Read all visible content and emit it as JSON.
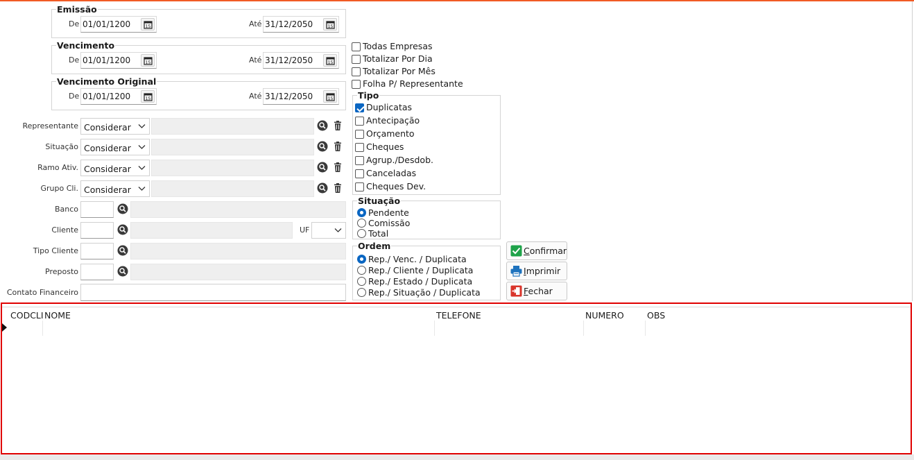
{
  "emissao": {
    "legend": "Emissão",
    "de_label": "De",
    "ate_label": "Até",
    "de_value": "01/01/1200",
    "ate_value": "31/12/2050"
  },
  "vencimento": {
    "legend": "Vencimento",
    "de_label": "De",
    "ate_label": "Até",
    "de_value": "01/01/1200",
    "ate_value": "31/12/2050"
  },
  "vencimento_original": {
    "legend": "Vencimento Original",
    "de_label": "De",
    "ate_label": "Até",
    "de_value": "01/01/1200",
    "ate_value": "31/12/2050"
  },
  "filters": {
    "representante": {
      "label": "Representante",
      "value": "Considerar"
    },
    "situacao": {
      "label": "Situação",
      "value": "Considerar"
    },
    "ramo": {
      "label": "Ramo Ativ.",
      "value": "Considerar"
    },
    "grupo": {
      "label": "Grupo Cli.",
      "value": "Considerar"
    }
  },
  "fields": {
    "banco": "Banco",
    "cliente": "Cliente",
    "uf": "UF",
    "tipo_cliente": "Tipo Cliente",
    "preposto": "Preposto",
    "contato": "Contato Financeiro"
  },
  "options": {
    "todas_empresas": "Todas Empresas",
    "totalizar_dia": "Totalizar Por Dia",
    "totalizar_mes": "Totalizar Por Mês",
    "folha_rep": "Folha P/ Representante"
  },
  "tipo": {
    "legend": "Tipo",
    "items": [
      "Duplicatas",
      "Antecipação",
      "Orçamento",
      "Cheques",
      "Agrup./Desdob.",
      "Canceladas",
      "Cheques Dev."
    ],
    "checked": [
      true,
      false,
      false,
      false,
      false,
      false,
      false
    ]
  },
  "situacao_grp": {
    "legend": "Situação",
    "items": [
      "Pendente",
      "Comissão",
      "Total"
    ],
    "selected_index": 0
  },
  "ordem": {
    "legend": "Ordem",
    "items": [
      "Rep./ Venc. / Duplicata",
      "Rep./ Cliente / Duplicata",
      "Rep./ Estado / Duplicata",
      "Rep./ Situação / Duplicata"
    ],
    "selected_index": 0
  },
  "buttons": {
    "confirmar_first": "C",
    "confirmar_rest": "onfirmar",
    "imprimir_first": "I",
    "imprimir_rest": "mprimir",
    "fechar_first": "F",
    "fechar_rest": "echar"
  },
  "grid": {
    "columns": [
      "CODCLI",
      "NOME",
      "TELEFONE",
      "NUMERO",
      "OBS"
    ]
  },
  "colors": {
    "accent_top": "#f15a24",
    "grid_border": "#e00000",
    "check_blue": "#0a66c2",
    "confirm_green": "#1fa34a",
    "print_blue": "#1e73be",
    "close_red": "#d9342b"
  }
}
